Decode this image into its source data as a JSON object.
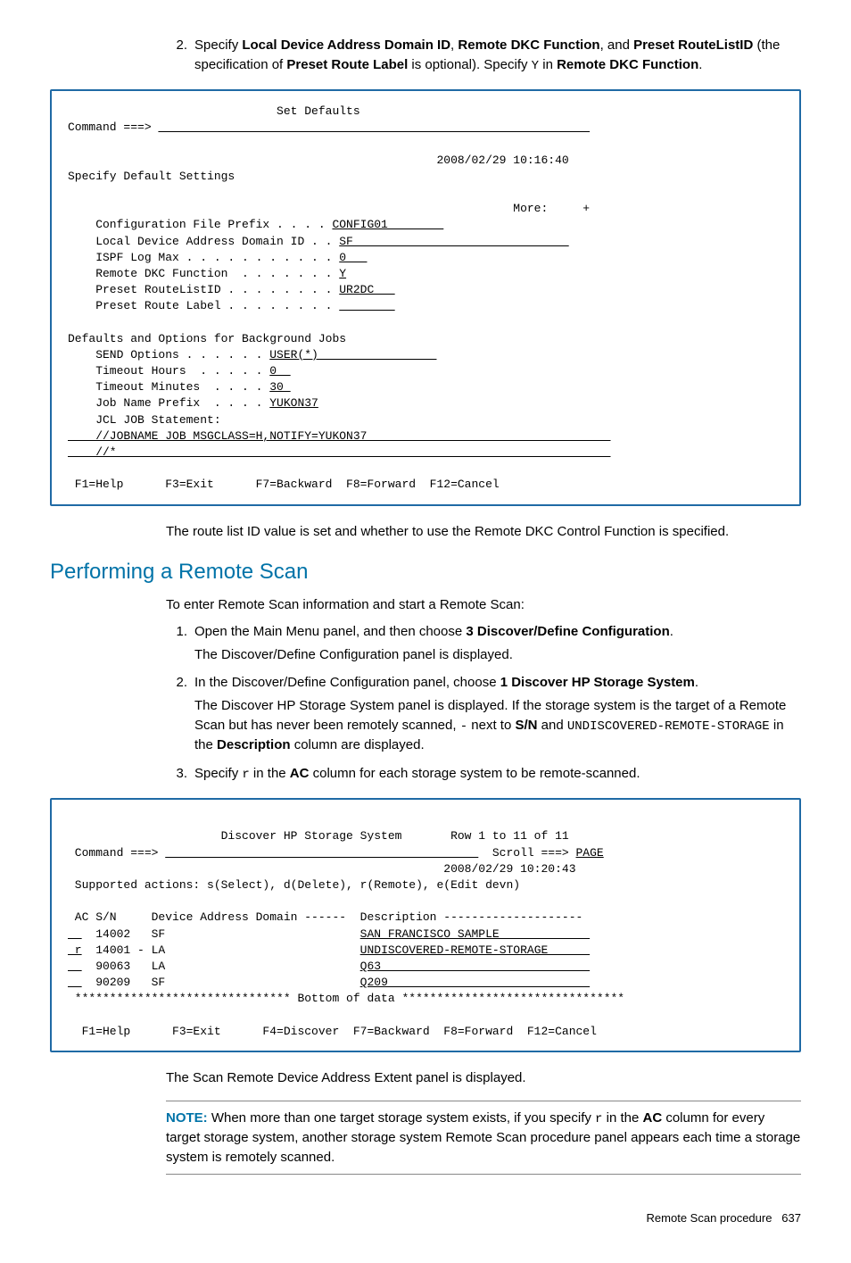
{
  "intro": {
    "step2_num": "2.",
    "step2_a": "Specify ",
    "step2_b1": "Local Device Address Domain ID",
    "step2_c": ", ",
    "step2_b2": "Remote DKC Function",
    "step2_d": ", and ",
    "step2_b3": "Preset RouteListID",
    "step2_e": " (the specification of ",
    "step2_b4": "Preset Route Label",
    "step2_f": " is optional). Specify ",
    "step2_y": "Y",
    "step2_g": " in ",
    "step2_b5": "Remote DKC Function",
    "step2_h": "."
  },
  "term1": {
    "title_line": "                              Set Defaults",
    "cmd_label": "Command ===> ",
    "timestamp": "                                                     2008/02/29 10:16:40",
    "specify": "Specify Default Settings",
    "more": "                                                                More:     +",
    "cfg_prefix_l": "    Configuration File Prefix . . . . ",
    "cfg_prefix_v": "CONFIG01        ",
    "ldad_l": "    Local Device Address Domain ID . . ",
    "ldad_v": "SF                               ",
    "ilog_l": "    ISPF Log Max . . . . . . . . . . . ",
    "ilog_v": "0   ",
    "rdkc_l": "    Remote DKC Function  . . . . . . . ",
    "rdkc_v": "Y",
    "prl_l": "    Preset RouteListID . . . . . . . . ",
    "prl_v": "UR2DC   ",
    "plabel_l": "    Preset Route Label . . . . . . . . ",
    "plabel_v": "        ",
    "bg_heading": "Defaults and Options for Background Jobs",
    "send_l": "    SEND Options . . . . . . ",
    "send_v": "USER(*)                 ",
    "th_l": "    Timeout Hours  . . . . . ",
    "th_v": "0  ",
    "tm_l": "    Timeout Minutes  . . . . ",
    "tm_v": "30 ",
    "jnp_l": "    Job Name Prefix  . . . . ",
    "jnp_v": "YUKON37",
    "jcl_label": "    JCL JOB Statement:",
    "jcl1": "    //JOBNAME JOB MSGCLASS=H,NOTIFY=YUKON37                                   ",
    "jcl2": "    //*                                                                       ",
    "fkeys": " F1=Help      F3=Exit      F7=Backward  F8=Forward  F12=Cancel"
  },
  "after_term1": "The route list ID value is set and whether to use the Remote DKC Control Function is specified.",
  "section_h": "Performing a Remote Scan",
  "intro2": "To enter Remote Scan information and start a Remote Scan:",
  "s1": {
    "num": "1.",
    "a": "Open the Main Menu panel, and then choose ",
    "b": "3 Discover/Define Configuration",
    "c": ".",
    "sub": "The Discover/Define Configuration panel is displayed."
  },
  "s2": {
    "num": "2.",
    "a": "In the Discover/Define Configuration panel, choose ",
    "b": "1 Discover HP Storage System",
    "c": ".",
    "sub1_a": "The Discover HP Storage System panel is displayed. If the storage system is the target of a Remote Scan but has never been remotely scanned, ",
    "sub1_dash": "-",
    "sub1_b": " next to ",
    "sub1_sn": "S/N",
    "sub1_c": " and ",
    "sub1_code": "UNDISCOVERED-REMOTE-STORAGE",
    "sub1_d": " in the ",
    "sub1_desc": "Description",
    "sub1_e": " column are displayed."
  },
  "s3": {
    "num": "3.",
    "a": "Specify ",
    "r": "r",
    "b": " in the ",
    "ac": "AC",
    "c": " column for each storage system to be remote-scanned."
  },
  "term2": {
    "title_line": "                      Discover HP Storage System       Row 1 to 11 of 11",
    "cmd_label": " Command ===> ",
    "scroll_l": "  Scroll ===> ",
    "scroll_v": "PAGE",
    "timestamp": "                                                      2008/02/29 10:20:43",
    "supported": " Supported actions: s(Select), d(Delete), r(Remote), e(Edit devn)",
    "col_head": " AC S/N     Device Address Domain ------  Description --------------------",
    "r1_ac": " _",
    "r1_sn": "  14002   SF                            ",
    "r1_desc": "SAN FRANCISCO SAMPLE             ",
    "r2_ac": " r",
    "r2_sn": "  14001 - LA                            ",
    "r2_desc": "UNDISCOVERED-REMOTE-STORAGE      ",
    "r3_ac": " _",
    "r3_sn": "  90063   LA                            ",
    "r3_desc": "Q63                              ",
    "r4_ac": " _",
    "r4_sn": "  90209   SF                            ",
    "r4_desc": "Q209                             ",
    "bottom": " ******************************* Bottom of data ********************************",
    "fkeys": "  F1=Help      F3=Exit      F4=Discover  F7=Backward  F8=Forward  F12=Cancel"
  },
  "after_term2": "The Scan Remote Device Address Extent panel is displayed.",
  "note": {
    "label": "NOTE:",
    "a": "   When more than one target storage system exists, if you specify ",
    "r": "r",
    "b": " in the ",
    "ac": "AC",
    "c": " column for every target storage system, another storage system Remote Scan procedure panel appears each time a storage system is remotely scanned."
  },
  "footer": {
    "text": "Remote Scan procedure",
    "page": "637"
  }
}
